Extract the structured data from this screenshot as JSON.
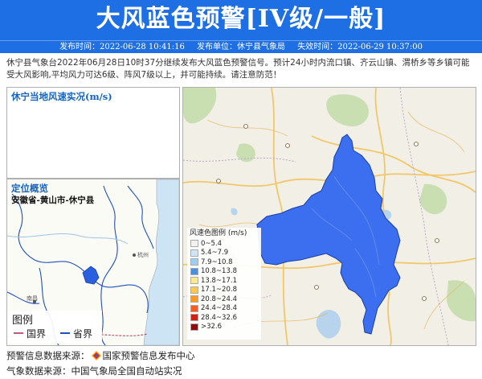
{
  "header": {
    "title": "大风蓝色预警[IV级/一般]",
    "issue_time": "发布时间：2022-06-28 10:41:16",
    "issuer": "发布单位：休宁县气象局",
    "expire_time": "失效时间：2022-06-29 10:37:00",
    "bg_color": "#1e6fe3"
  },
  "description": "休宁县气象台2022年06月28日10时37分继续发布大风蓝色预警信号。预计24小时内流口镇、齐云山镇、渭桥乡等乡镇可能受大风影响,平均风力可达6级、阵风7级以上，并可能持续。请注意防范！",
  "wind_panel": {
    "title": "休宁当地风速实况(m/s)"
  },
  "location_panel": {
    "title": "定位概览",
    "region": "安徽省-黄山市-休宁县",
    "map_labels": [
      "杭州",
      "南昌"
    ],
    "legend_title": "图例",
    "legend_items": [
      {
        "label": "国界",
        "color": "#c05a7a"
      },
      {
        "label": "省界",
        "color": "#2050c0"
      }
    ]
  },
  "main_map": {
    "highlight_color": "#3b6ff0",
    "legend_title": "风速色图例 (m/s)",
    "legend": [
      {
        "label": "0~5.4",
        "color": "#f2f2f2"
      },
      {
        "label": "5.4~7.9",
        "color": "#cfe6fa"
      },
      {
        "label": "7.9~10.8",
        "color": "#9ccff0"
      },
      {
        "label": "10.8~13.8",
        "color": "#4a90e2"
      },
      {
        "label": "13.8~17.1",
        "color": "#ffe98a"
      },
      {
        "label": "17.1~20.8",
        "color": "#ffc94a"
      },
      {
        "label": "20.8~24.4",
        "color": "#ff9a1f"
      },
      {
        "label": "24.4~28.4",
        "color": "#ff5a1f"
      },
      {
        "label": "28.4~32.6",
        "color": "#d61e10"
      },
      {
        "label": ">32.6",
        "color": "#8f0c0c"
      }
    ]
  },
  "footer": {
    "warning_source_label": "预警信息数据来源：",
    "warning_source_name": "国家预警信息发布中心",
    "weather_source": "气象数据来源：中国气象局全国自动站实况"
  }
}
